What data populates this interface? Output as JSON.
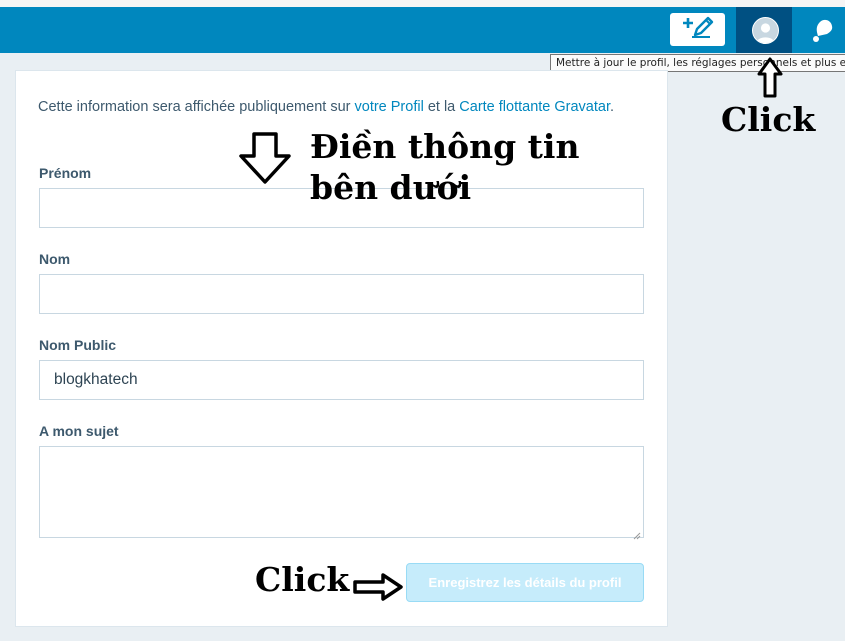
{
  "masterbar": {
    "color": "#0087be",
    "write_button": {
      "icon": "write-post-icon"
    },
    "me_button": {
      "icon": "avatar-placeholder-icon"
    },
    "notifications_button": {
      "icon": "bell-notification-icon"
    },
    "tooltip": "Mettre à jour le profil, les réglages personnels et plus en"
  },
  "form": {
    "intro_text_1": "Cette information sera affichée publiquement sur ",
    "intro_link_profile": "votre Profil",
    "intro_text_2": " et la ",
    "intro_link_gravatar": "Carte flottante Gravatar",
    "intro_text_3": ".",
    "first_name_label": "Prénom",
    "first_name_value": "",
    "last_name_label": "Nom",
    "last_name_value": "",
    "display_name_label": "Nom Public",
    "display_name_value": "blogkhatech",
    "about_label": "A mon sujet",
    "about_value": "",
    "save_button_label": "Enregistrez les détails du profil"
  },
  "annotations": {
    "click_top": "Click",
    "fill_info": "Điền thông tin bên dưới",
    "click_bottom": "Click"
  }
}
